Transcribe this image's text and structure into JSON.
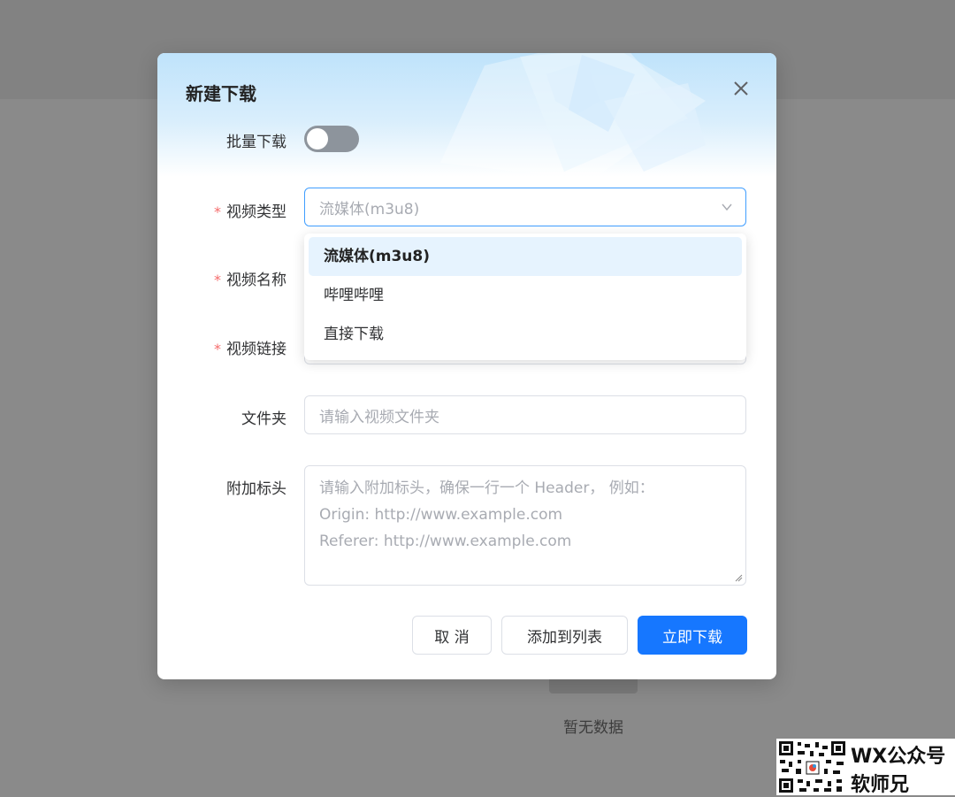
{
  "background": {
    "empty_text": "暂无数据"
  },
  "dialog": {
    "title": "新建下载",
    "close_icon": "close-icon",
    "form": {
      "batch": {
        "label": "批量下载",
        "enabled": false
      },
      "video_type": {
        "label": "视频类型",
        "required": true,
        "placeholder": "流媒体(m3u8)",
        "options": [
          "流媒体(m3u8)",
          "哔哩哔哩",
          "直接下载"
        ],
        "highlighted_option": "流媒体(m3u8)"
      },
      "video_name": {
        "label": "视频名称",
        "required": true
      },
      "video_link": {
        "label": "视频链接",
        "required": true
      },
      "folder": {
        "label": "文件夹",
        "placeholder": "请输入视频文件夹"
      },
      "headers": {
        "label": "附加标头",
        "placeholder_lines": [
          "请输入附加标头，确保一行一个 Header， 例如：",
          "Origin: http://www.example.com",
          "Referer: http://www.example.com"
        ]
      }
    },
    "buttons": {
      "cancel": "取 消",
      "add_to_list": "添加到列表",
      "download_now": "立即下载"
    }
  },
  "colors": {
    "primary": "#1677ff",
    "required": "#f56c6c",
    "focus_border": "#409eff",
    "switch_off": "#8d949c",
    "dropdown_highlight": "#e6f3fe"
  },
  "watermark": {
    "line1": "WX公众号",
    "line2": "软师兄"
  }
}
